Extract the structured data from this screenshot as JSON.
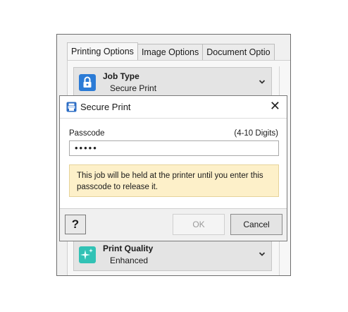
{
  "background": {
    "tabs": [
      "Printing Options",
      "Image Options",
      "Document Optio"
    ],
    "job_type": {
      "name": "Job Type",
      "value": "Secure Print",
      "icon": "lock-icon",
      "color": "#2b7bd6"
    },
    "print_quality": {
      "name": "Print Quality",
      "value": "Enhanced",
      "icon": "sparkle-icon",
      "color": "#31c2b5"
    }
  },
  "dialog": {
    "title": "Secure Print",
    "close": "✕",
    "passcode_label": "Passcode",
    "passcode_hint": "(4-10 Digits)",
    "passcode_value": "•••••",
    "note": "This job will be held at the printer until you enter this passcode to release it.",
    "help": "?",
    "ok": "OK",
    "cancel": "Cancel"
  }
}
